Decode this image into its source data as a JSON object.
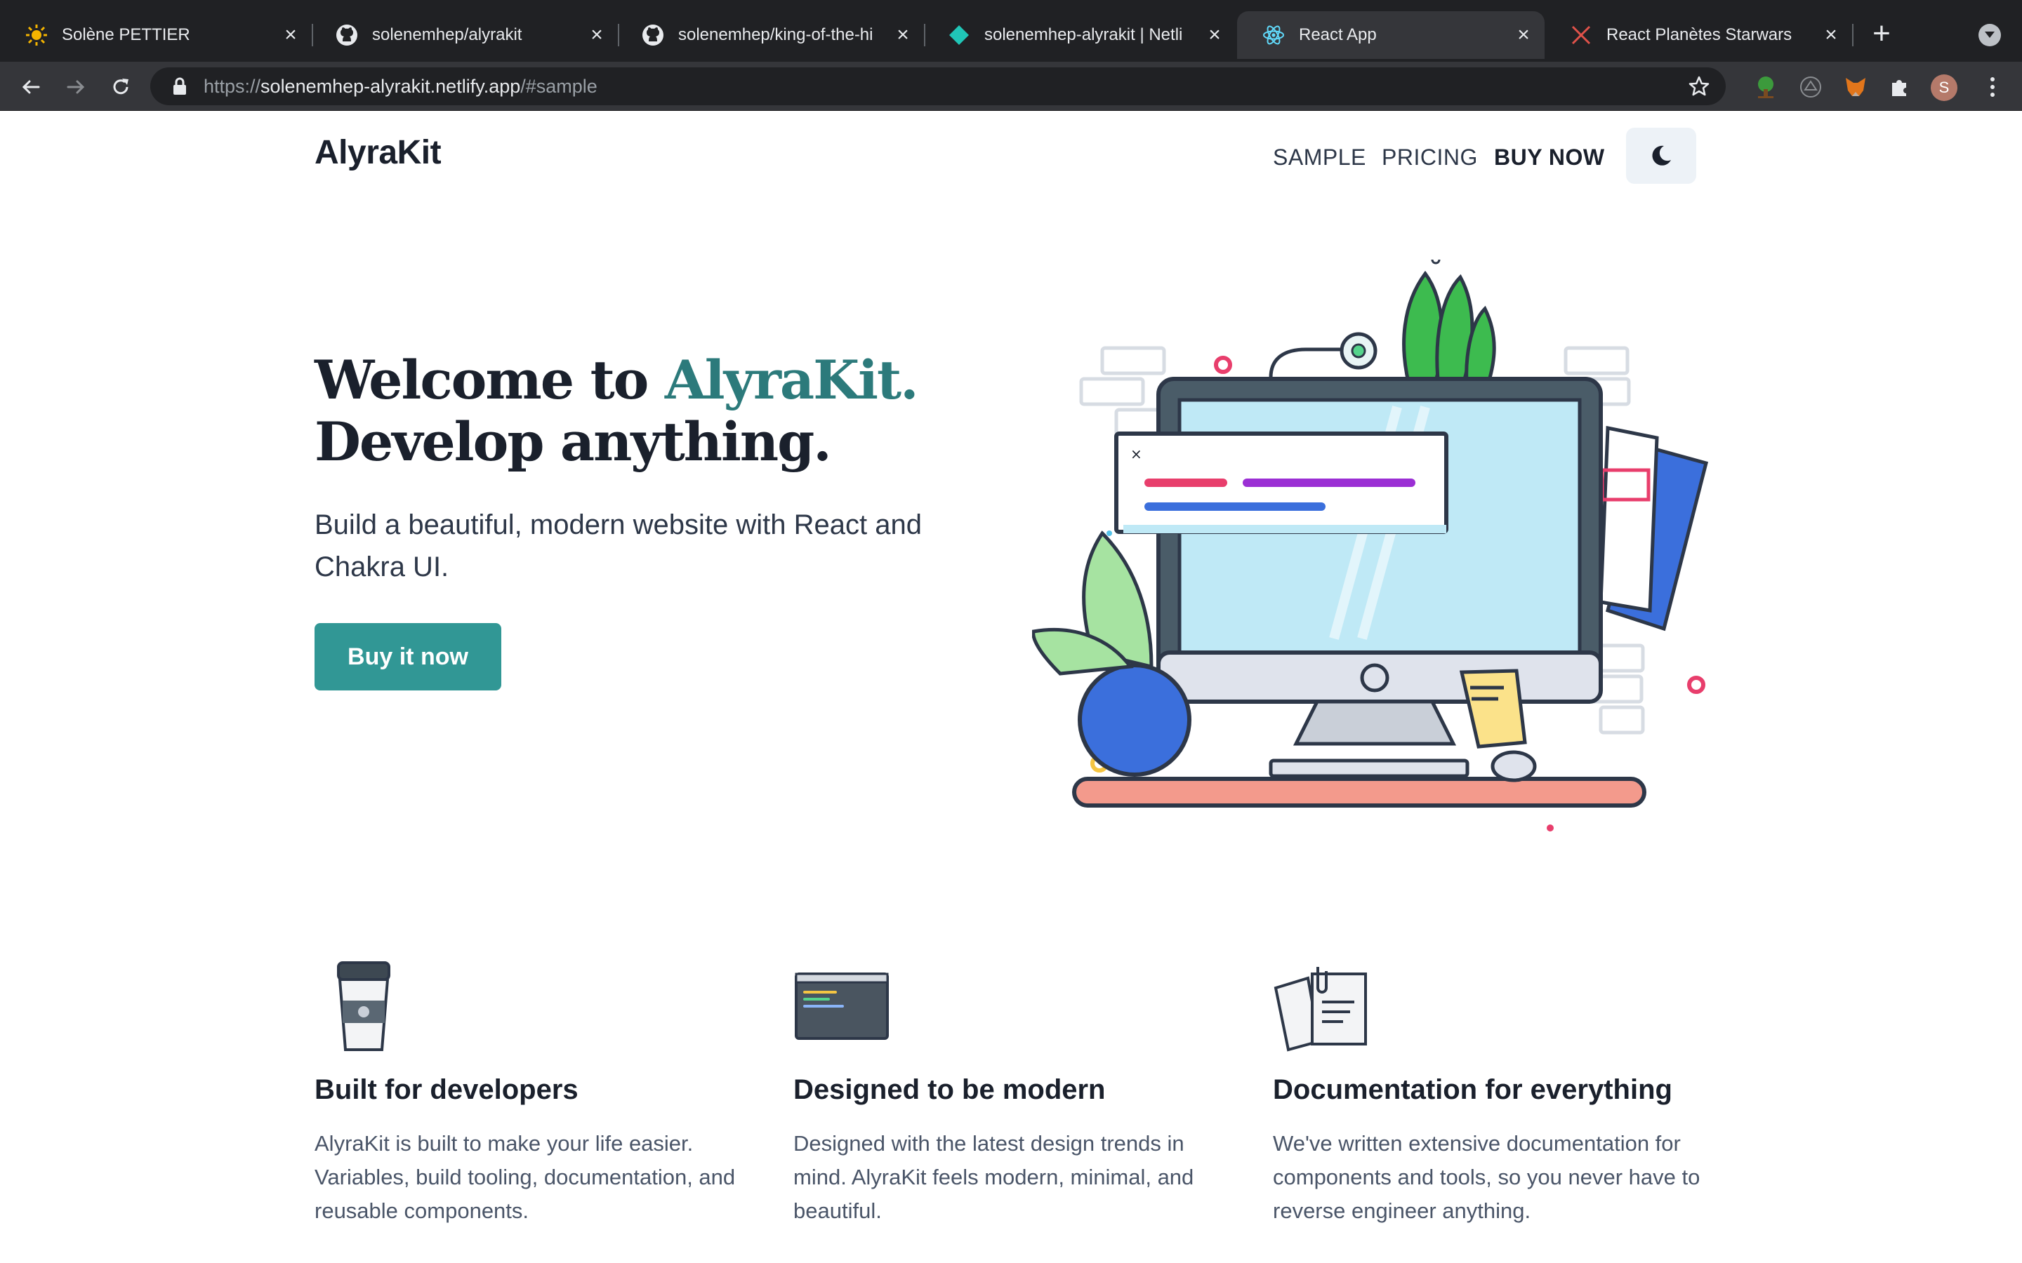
{
  "browser": {
    "tabs": [
      {
        "title": "Solène PETTIER",
        "icon": "sun-favicon-icon",
        "active": false
      },
      {
        "title": "solenemhep/alyrakit",
        "icon": "github-icon",
        "active": false
      },
      {
        "title": "solenemhep/king-of-the-hi",
        "icon": "github-icon",
        "active": false
      },
      {
        "title": "solenemhep-alyrakit | Netli",
        "icon": "netlify-icon",
        "active": false
      },
      {
        "title": "React App",
        "icon": "react-icon",
        "active": true
      },
      {
        "title": "React Planètes Starwars",
        "icon": "starwars-icon",
        "active": false
      }
    ],
    "url_scheme": "https://",
    "url_host": "solenemhep-alyrakit.netlify.app",
    "url_path": "/#sample",
    "profile_initial": "S"
  },
  "header": {
    "brand": "AlyraKit",
    "nav": [
      "SAMPLE",
      "PRICING",
      "BUY NOW"
    ]
  },
  "hero": {
    "title_prefix": "Welcome to ",
    "title_accent": "AlyraKit.",
    "title_line2": "Develop anything.",
    "subtitle": "Build a beautiful, modern website with React and Chakra UI.",
    "cta": "Buy it now"
  },
  "features": [
    {
      "icon": "coffee-cup-icon",
      "title": "Built for developers",
      "text": "AlyraKit is built to make your life easier. Variables, build tooling, documentation, and reusable components."
    },
    {
      "icon": "code-window-icon",
      "title": "Designed to be modern",
      "text": "Designed with the latest design trends in mind. AlyraKit feels modern, minimal, and beautiful."
    },
    {
      "icon": "documents-icon",
      "title": "Documentation for everything",
      "text": "We've written extensive documentation for components and tools, so you never have to reverse engineer anything."
    }
  ],
  "colors": {
    "accent": "#2c7a7b",
    "button": "#319795",
    "heading": "#1a202c",
    "body_text": "#4a5568"
  }
}
